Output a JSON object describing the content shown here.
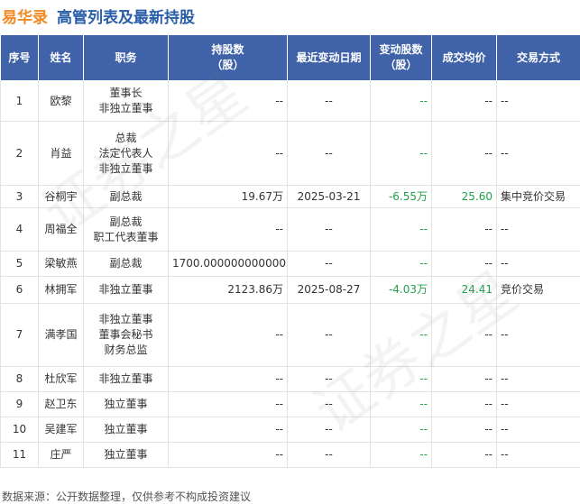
{
  "header": {
    "brand": "易华录",
    "title": "高管列表及最新持股"
  },
  "table": {
    "columns": [
      "序号",
      "姓名",
      "职务",
      "持股数\n（股）",
      "最近变动日期",
      "变动股数\n（股）",
      "成交均价",
      "交易方式"
    ],
    "rows": [
      {
        "no": "1",
        "name": "欧黎",
        "roles": [
          "董事长",
          "非独立董事"
        ],
        "shares": "--",
        "date": "--",
        "change": "--",
        "price": "--",
        "method": "--",
        "h": 45
      },
      {
        "no": "2",
        "name": "肖益",
        "roles": [
          "总裁",
          "法定代表人",
          "非独立董事"
        ],
        "shares": "--",
        "date": "--",
        "change": "--",
        "price": "--",
        "method": "--",
        "h": 71
      },
      {
        "no": "3",
        "name": "谷桐宇",
        "roles": [
          "副总裁"
        ],
        "shares": "19.67万",
        "date": "2025-03-21",
        "change": "-6.55万",
        "price": "25.60",
        "method": "集中竞价交易",
        "h": 25
      },
      {
        "no": "4",
        "name": "周福全",
        "roles": [
          "副总裁",
          "职工代表董事"
        ],
        "shares": "--",
        "date": "--",
        "change": "--",
        "price": "--",
        "method": "--",
        "h": 48
      },
      {
        "no": "5",
        "name": "梁敏燕",
        "roles": [
          "副总裁"
        ],
        "shares": "1700.0000000000002",
        "date": "--",
        "change": "--",
        "price": "--",
        "method": "--",
        "h": 28
      },
      {
        "no": "6",
        "name": "林拥军",
        "roles": [
          "非独立董事"
        ],
        "shares": "2123.86万",
        "date": "2025-08-27",
        "change": "-4.03万",
        "price": "24.41",
        "method": "竞价交易",
        "h": 30
      },
      {
        "no": "7",
        "name": "满孝国",
        "roles": [
          "非独立董事",
          "董事会秘书",
          "财务总监"
        ],
        "shares": "--",
        "date": "--",
        "change": "--",
        "price": "--",
        "method": "--",
        "h": 70
      },
      {
        "no": "8",
        "name": "杜欣军",
        "roles": [
          "非独立董事"
        ],
        "shares": "--",
        "date": "--",
        "change": "--",
        "price": "--",
        "method": "--",
        "h": 28
      },
      {
        "no": "9",
        "name": "赵卫东",
        "roles": [
          "独立董事"
        ],
        "shares": "--",
        "date": "--",
        "change": "--",
        "price": "--",
        "method": "--",
        "h": 28
      },
      {
        "no": "10",
        "name": "吴建军",
        "roles": [
          "独立董事"
        ],
        "shares": "--",
        "date": "--",
        "change": "--",
        "price": "--",
        "method": "--",
        "h": 28
      },
      {
        "no": "11",
        "name": "庄严",
        "roles": [
          "独立董事"
        ],
        "shares": "--",
        "date": "--",
        "change": "--",
        "price": "--",
        "method": "--",
        "h": 28
      }
    ]
  },
  "footer": {
    "text": "数据来源：公开数据整理，仅供参考不构成投资建议"
  },
  "colors": {
    "header_bg": "#3f62a8",
    "brand": "#f08a24",
    "title": "#2a5ea8",
    "negative": "#23a04a",
    "positive": "#e23b3b"
  }
}
